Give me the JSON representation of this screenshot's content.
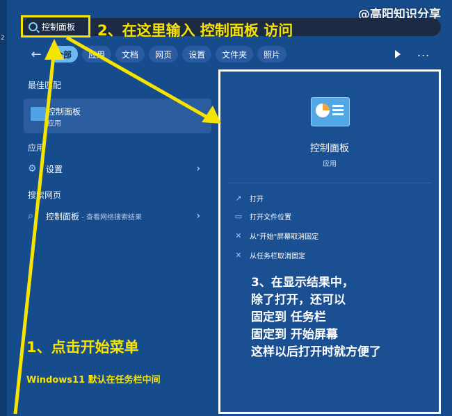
{
  "header": {
    "watermark": "@高阳知识分享",
    "left_digit": "2"
  },
  "search": {
    "value": "控制面板",
    "instruction": "2、在这里输入 控制面板 访问"
  },
  "filters": {
    "back_icon": "arrow-left-icon",
    "chips": [
      {
        "label": "全部",
        "active": true
      },
      {
        "label": "应用"
      },
      {
        "label": "文档"
      },
      {
        "label": "网页"
      },
      {
        "label": "设置"
      },
      {
        "label": "文件夹"
      },
      {
        "label": "照片"
      }
    ],
    "more": "..."
  },
  "left": {
    "best_match_title": "最佳匹配",
    "best_match": {
      "title": "控制面板",
      "subtitle": "应用"
    },
    "apps_title": "应用",
    "settings_item": "设置",
    "web_title": "搜索网页",
    "web_item_main": "控制面板",
    "web_item_suffix": " - 查看网络搜索结果"
  },
  "panel": {
    "app_name": "控制面板",
    "app_type": "应用",
    "actions": [
      {
        "label": "打开",
        "icon": "open-external-icon"
      },
      {
        "label": "打开文件位置",
        "icon": "folder-icon"
      },
      {
        "label": "从\"开始\"屏幕取消固定",
        "icon": "unpin-icon"
      },
      {
        "label": "从任务栏取消固定",
        "icon": "unpin-icon"
      }
    ]
  },
  "annotations": {
    "step3_lines": [
      "3、在显示结果中，",
      "除了打开，还可以",
      "固定到 任务栏",
      "固定到 开始屏幕",
      "这样以后打开时就方便了"
    ],
    "step1": "1、点击开始菜单",
    "hint": "Windows11 默认在任务栏中间"
  },
  "colors": {
    "accent_yellow": "#f5e400",
    "panel_bg": "#164b8c"
  }
}
